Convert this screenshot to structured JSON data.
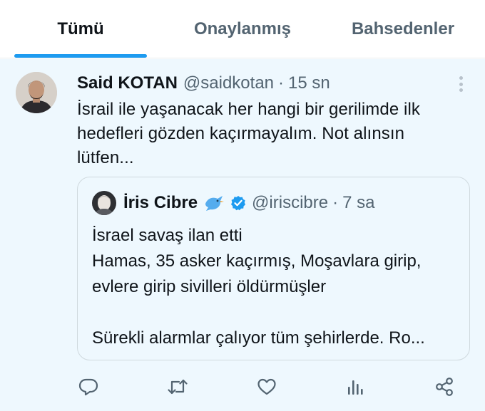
{
  "tabs": [
    {
      "label": "Tümü",
      "active": true
    },
    {
      "label": "Onaylanmış",
      "active": false
    },
    {
      "label": "Bahsedenler",
      "active": false
    }
  ],
  "tweet": {
    "display_name": "Said KOTAN",
    "handle": "@saidkotan",
    "separator": "·",
    "time": "15 sn",
    "text": "İsrail ile yaşanacak her hangi bir gerilimde ilk\nhedefleri gözden kaçırmayalım. Not alınsın\nlütfen...",
    "quote": {
      "display_name": "İris Cibre",
      "emoji": "bird-emoji",
      "verified": true,
      "handle": "@iriscibre",
      "separator": "·",
      "time": "7 sa",
      "text": "İsrael savaş ilan etti\nHamas, 35 asker kaçırmış, Moşavlara girip,\nevlere girip sivilleri öldürmüşler\n\nSürekli alarmlar çalıyor tüm şehirlerde. Ro..."
    },
    "actions": [
      "reply-icon",
      "retweet-icon",
      "like-icon",
      "views-icon",
      "share-icon"
    ]
  },
  "colors": {
    "accent": "#1d9bf0",
    "tweet_background": "#eef8fe",
    "secondary_text": "#536471",
    "icon": "#536471"
  }
}
